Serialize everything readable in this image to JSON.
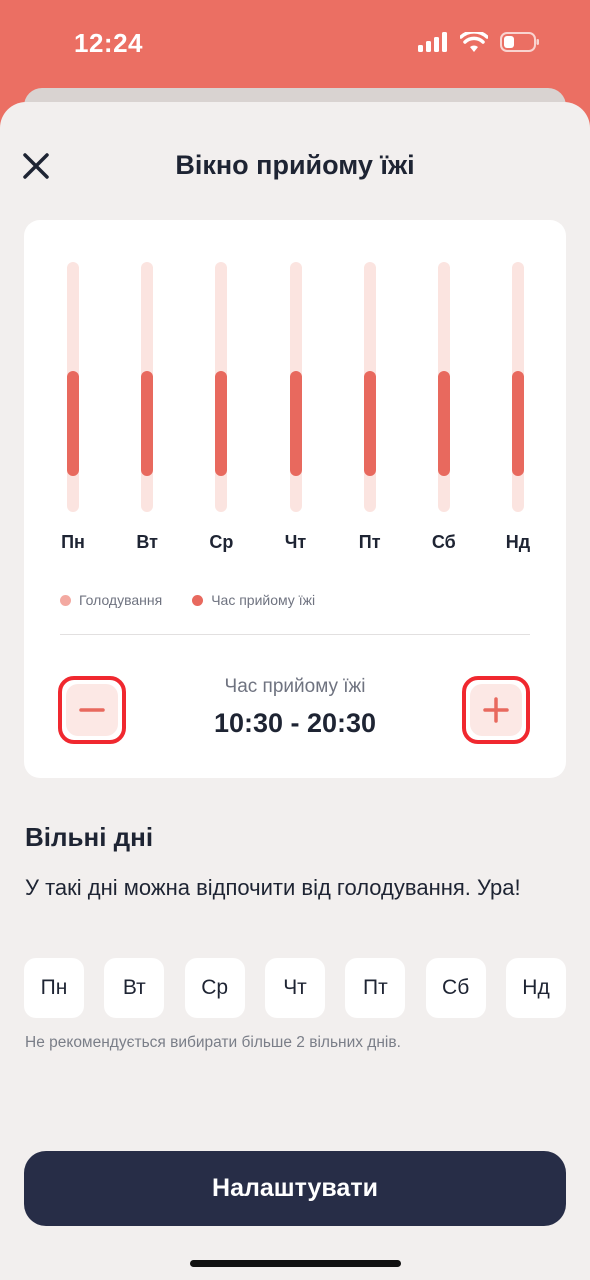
{
  "status_bar": {
    "time": "12:24"
  },
  "header": {
    "title": "Вікно прийому їжі"
  },
  "chart_data": {
    "type": "bar",
    "categories": [
      "Пн",
      "Вт",
      "Ср",
      "Чт",
      "Пт",
      "Сб",
      "Нд"
    ],
    "series": [
      {
        "name": "Голодування",
        "values": [
          24,
          24,
          24,
          24,
          24,
          24,
          24
        ]
      },
      {
        "name": "Час прийому їжі",
        "values": [
          10,
          10,
          10,
          10,
          10,
          10,
          10
        ]
      }
    ],
    "eating_window": {
      "start": 10.5,
      "end": 20.5
    },
    "ylim": [
      0,
      24
    ],
    "legend": [
      "Голодування",
      "Час прийому їжі"
    ],
    "legend_position": "bottom-left",
    "colors": {
      "fasting": "#F3A9A1",
      "eating": "#E8695E",
      "track": "#FBE4E0"
    }
  },
  "time_card": {
    "caption": "Час прийому їжі",
    "value": "10:30 - 20:30",
    "decrease_icon": "minus-icon",
    "increase_icon": "plus-icon"
  },
  "free_days": {
    "title": "Вільні дні",
    "description": "У такі дні можна відпочити від голодування. Ура!",
    "days": [
      "Пн",
      "Вт",
      "Ср",
      "Чт",
      "Пт",
      "Сб",
      "Нд"
    ],
    "note": "Не рекомендується вибирати більше 2 вільних днів."
  },
  "actions": {
    "primary_label": "Налаштувати"
  },
  "colors": {
    "accent": "#EB6F63",
    "highlight": "#F0282F",
    "dark": "#272D47"
  }
}
